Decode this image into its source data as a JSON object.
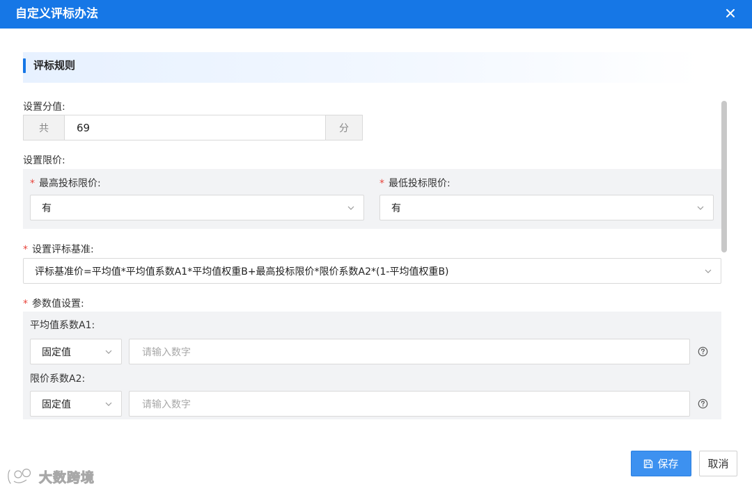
{
  "dialog": {
    "title": "自定义评标办法",
    "close_icon": "close-icon"
  },
  "section": {
    "title": "评标规则"
  },
  "score": {
    "label": "设置分值:",
    "prefix": "共",
    "value": "69",
    "suffix": "分"
  },
  "limit_price": {
    "label": "设置限价:",
    "max": {
      "required_mark": "*",
      "label": "最高投标限价:",
      "value": "有"
    },
    "min": {
      "required_mark": "*",
      "label": "最低投标限价:",
      "value": "有"
    }
  },
  "benchmark": {
    "required_mark": "*",
    "label": "设置评标基准:",
    "value": "评标基准价=平均值*平均值系数A1*平均值权重B+最高投标限价*限价系数A2*(1-平均值权重B)"
  },
  "params": {
    "required_mark": "*",
    "label": "参数值设置:",
    "items": [
      {
        "label": "平均值系数A1:",
        "mode": "固定值",
        "placeholder": "请输入数字"
      },
      {
        "label": "限价系数A2:",
        "mode": "固定值",
        "placeholder": "请输入数字"
      }
    ]
  },
  "footer": {
    "save_label": "保存",
    "cancel_label": "取消"
  },
  "watermark": {
    "text": "大数跨境"
  },
  "colors": {
    "brand": "#1677e6",
    "required": "#e8453c",
    "save_button": "#3d91f0"
  }
}
